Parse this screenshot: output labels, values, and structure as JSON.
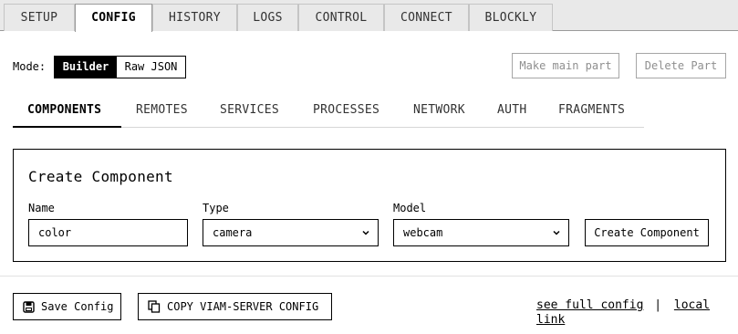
{
  "top_tabs": [
    "SETUP",
    "CONFIG",
    "HISTORY",
    "LOGS",
    "CONTROL",
    "CONNECT",
    "BLOCKLY"
  ],
  "active_top_tab": "CONFIG",
  "mode": {
    "label": "Mode:",
    "options": [
      "Builder",
      "Raw JSON"
    ],
    "selected": "Builder"
  },
  "actions": {
    "make_main_part": "Make main part",
    "delete_part": "Delete Part"
  },
  "sub_tabs": [
    "COMPONENTS",
    "REMOTES",
    "SERVICES",
    "PROCESSES",
    "NETWORK",
    "AUTH",
    "FRAGMENTS"
  ],
  "active_sub_tab": "COMPONENTS",
  "create_component": {
    "title": "Create Component",
    "name_label": "Name",
    "name_value": "color",
    "type_label": "Type",
    "type_value": "camera",
    "model_label": "Model",
    "model_value": "webcam",
    "submit_label": "Create Component"
  },
  "footer": {
    "save_label": "Save Config",
    "copy_label": "COPY VIAM-SERVER CONFIG",
    "full_config_link": "see full config",
    "separator": "|",
    "local_link": "local link"
  },
  "icons": {
    "save": "save-icon",
    "copy": "copy-icon",
    "select_chevron": "chevron-down-icon"
  }
}
